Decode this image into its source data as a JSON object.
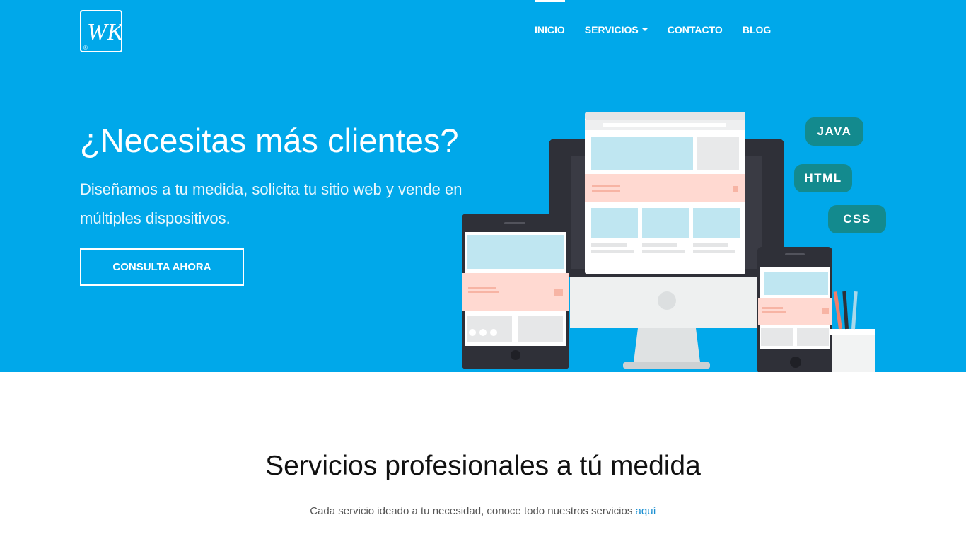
{
  "brand": {
    "logo_text": "WK",
    "logo_mark": "®"
  },
  "nav": {
    "items": [
      {
        "label": "INICIO",
        "active": true
      },
      {
        "label": "SERVICIOS",
        "dropdown": true
      },
      {
        "label": "CONTACTO"
      },
      {
        "label": "BLOG"
      }
    ]
  },
  "hero": {
    "title": "¿Necesitas más clientes?",
    "subtitle": "Diseñamos a tu medida, solicita tu sitio web y vende en múltiples dispositivos.",
    "cta_label": "CONSULTA AHORA",
    "tags": [
      "JAVA",
      "HTML",
      "CSS"
    ],
    "background_color": "#00a8ea"
  },
  "services": {
    "title": "Servicios profesionales a tú medida",
    "description": "Cada servicio ideado a tu necesidad, conoce todo nuestros servicios",
    "link_label": "aquí"
  }
}
